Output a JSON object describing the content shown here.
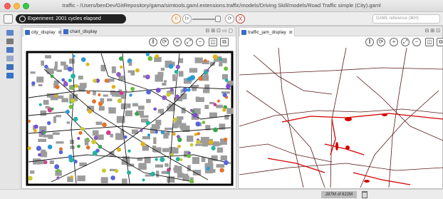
{
  "window": {
    "title": "traffic - /Users/benDev/GitRepository/gama/simtools.gaml.extensions.traffic/models/Driving Skill/models/Road Traffic simple (City).gaml"
  },
  "toolbar": {
    "status_text": "Experiment: 2001 cycles elapsed",
    "pause_label": "II",
    "step_label": "I>",
    "stop_label": "X",
    "search_placeholder": "GAML reference (⌘H)"
  },
  "left_panel": {
    "tabs": [
      {
        "label": "city_display",
        "close": "⊠",
        "active": true
      },
      {
        "label": "chart_display",
        "close": "",
        "active": false
      }
    ],
    "window_controls": "⊟ ⊞ ⊡ ▭ ▢"
  },
  "right_panel": {
    "tabs": [
      {
        "label": "traffic_jam_display",
        "close": "⊠",
        "active": true
      }
    ],
    "window_controls": "⊟ ⊞ ⊡"
  },
  "view_tools": [
    "pause",
    "sync",
    "zoom-in",
    "fit",
    "zoom-out",
    "snapshot",
    "camera"
  ],
  "status": {
    "memory": "287M of 622M"
  },
  "colors": {
    "accent_orange": "#e58a2c",
    "stop_red": "#c8322b",
    "jam_red": "#d40000",
    "road_dark": "#5a1a1a"
  }
}
